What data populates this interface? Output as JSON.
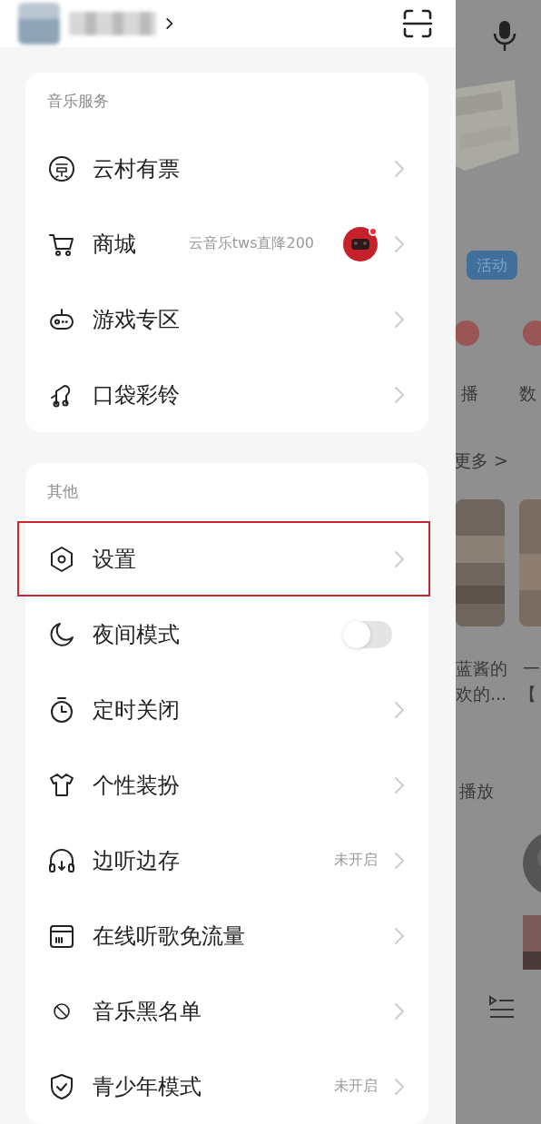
{
  "sections": [
    {
      "heading": "音乐服务",
      "items": [
        {
          "kind": "link",
          "label": "云村有票"
        },
        {
          "kind": "link",
          "label": "商城",
          "detail": "云音乐tws直降200",
          "badge": {
            "kind": "picture",
            "dot": true
          }
        },
        {
          "kind": "link",
          "label": "游戏专区"
        },
        {
          "kind": "link",
          "label": "口袋彩铃"
        }
      ]
    },
    {
      "heading": "其他",
      "items": [
        {
          "kind": "link",
          "label": "设置",
          "highlighted": true
        },
        {
          "kind": "toggle",
          "label": "夜间模式",
          "on": false
        },
        {
          "kind": "link",
          "label": "定时关闭"
        },
        {
          "kind": "link",
          "label": "个性装扮"
        },
        {
          "kind": "link",
          "label": "边听边存",
          "detail": "未开启"
        },
        {
          "kind": "link",
          "label": "在线听歌免流量"
        },
        {
          "kind": "link",
          "label": "音乐黑名单"
        },
        {
          "kind": "link",
          "label": "青少年模式",
          "detail": "未开启"
        }
      ]
    }
  ],
  "background": {
    "tag": "活动",
    "labels": [
      "播",
      "数"
    ],
    "more": "更多 >",
    "captions": [
      "蓝酱的",
      "欢的...",
      "一",
      "【"
    ],
    "play_label": "播放"
  }
}
